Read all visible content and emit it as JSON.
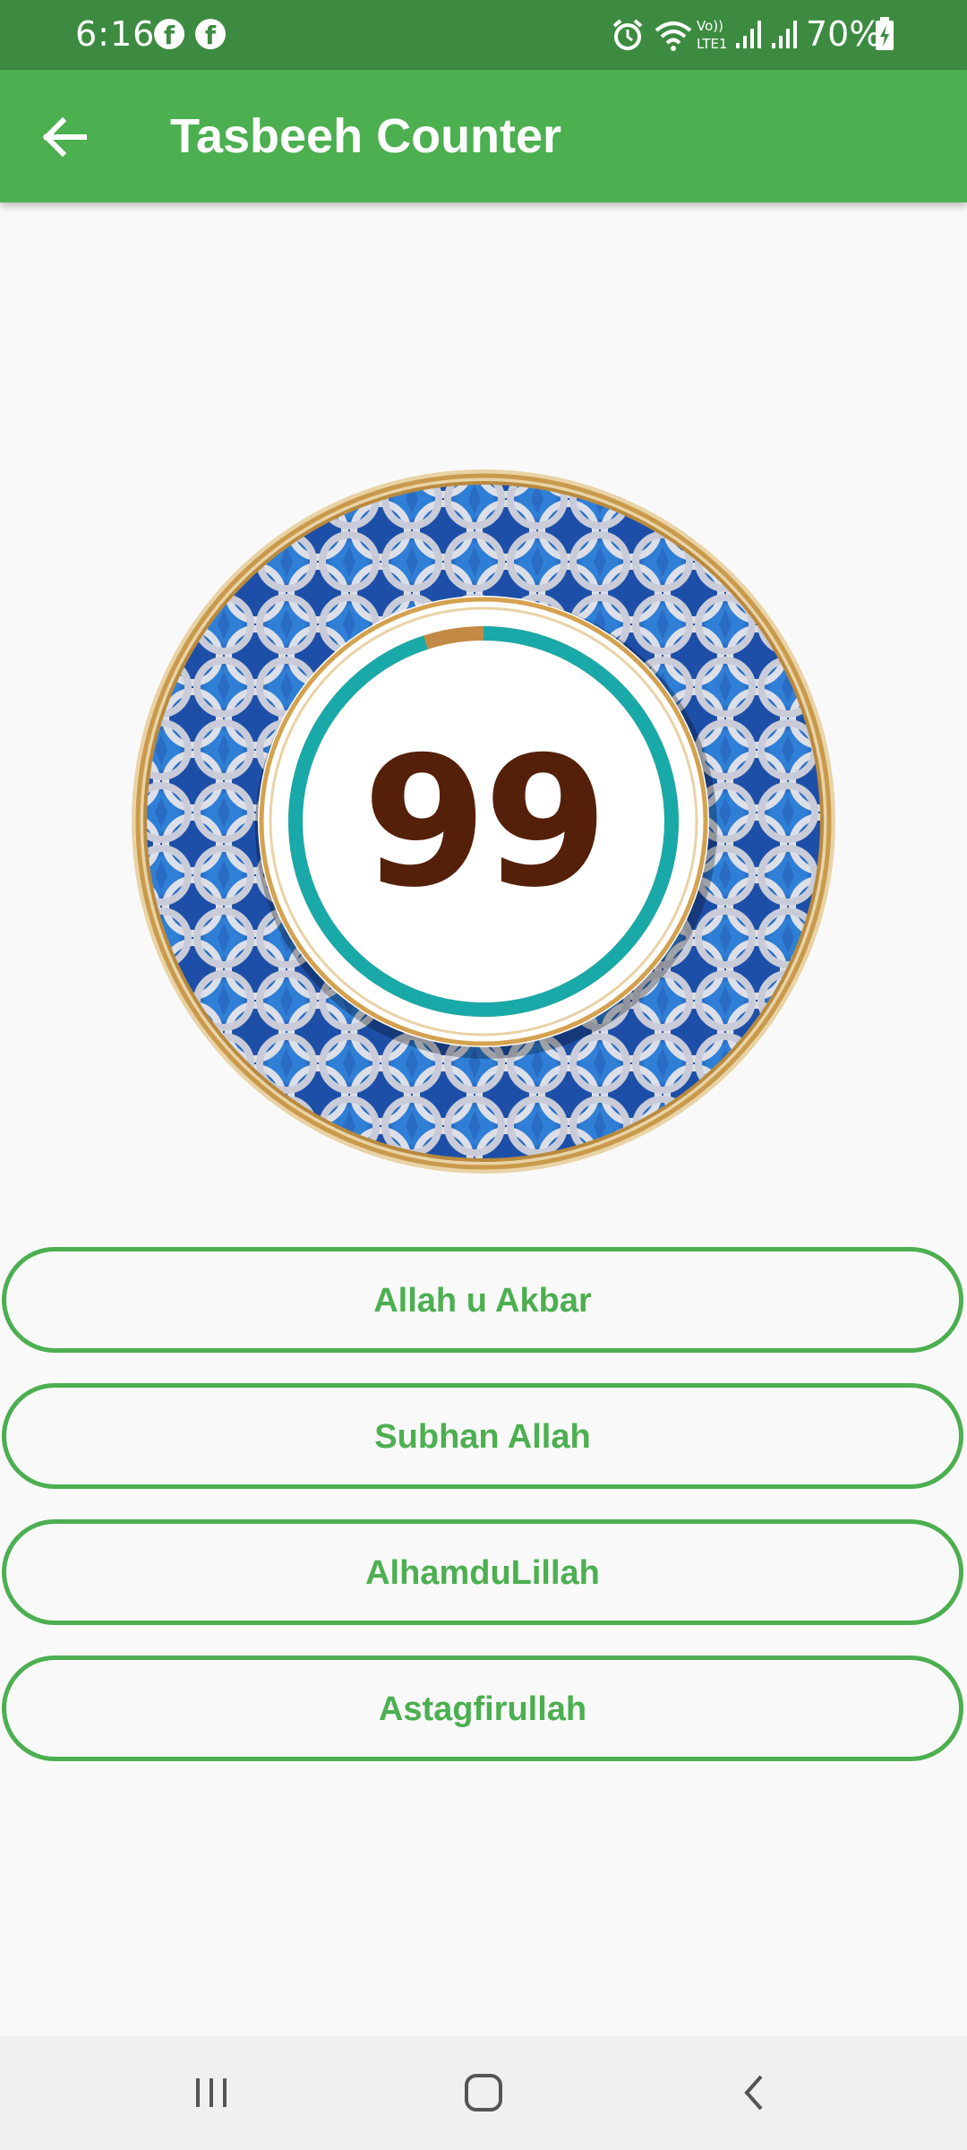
{
  "status_bar": {
    "time": "6:16",
    "notification_icons": [
      "facebook-icon",
      "facebook-icon"
    ],
    "system_icons": [
      "alarm-icon",
      "wifi-icon",
      "volte-lte-icon",
      "signal-icon",
      "signal-icon",
      "battery-charging-icon"
    ],
    "battery": "70%",
    "fb_glyph": "f"
  },
  "app_bar": {
    "title": "Tasbeeh Counter",
    "back_icon": "arrow-back-icon",
    "background": "#4caf50"
  },
  "counter": {
    "value": "99",
    "progress_fraction": 0.95,
    "progress_color": "#1aa9a9",
    "remainder_color": "#c38a46",
    "number_color": "#55200a"
  },
  "buttons": [
    {
      "label": "Allah u Akbar"
    },
    {
      "label": "Subhan Allah"
    },
    {
      "label": "AlhamduLillah"
    },
    {
      "label": "Astagfirullah"
    }
  ],
  "nav_bar": {
    "icons": [
      "recent-apps-icon",
      "home-icon",
      "back-icon"
    ]
  },
  "colors": {
    "accent": "#4caf50",
    "status_bar": "#3d8b40",
    "background": "#f9f9f9"
  }
}
